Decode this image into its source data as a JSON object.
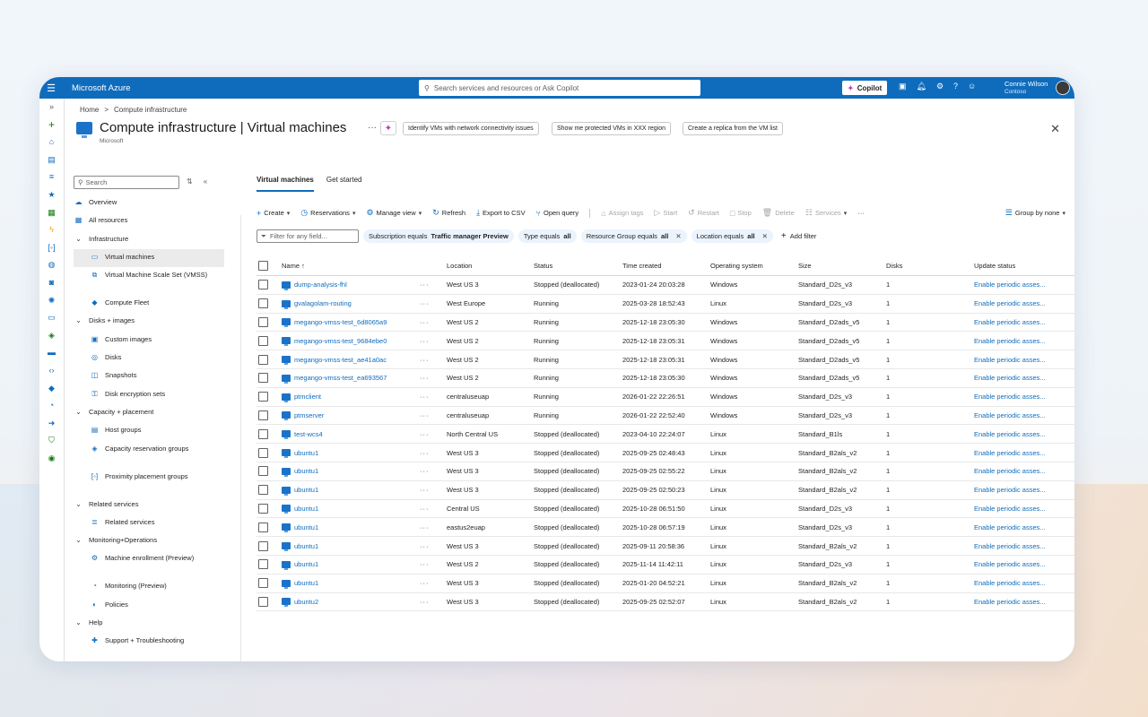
{
  "topbar": {
    "brand": "Microsoft Azure",
    "search_placeholder": "Search services and resources or Ask Copilot",
    "copilot_label": "Copilot",
    "user_name": "Connie Wilson",
    "user_org": "Contoso"
  },
  "breadcrumb": [
    "Home",
    "Compute infrastructure"
  ],
  "page": {
    "title": "Compute infrastructure | Virtual machines",
    "subtitle": "Microsoft",
    "suggestions": [
      "Identify VMs with network connectivity issues",
      "Show me protected VMs in XXX region",
      "Create a replica from the VM list"
    ]
  },
  "leftnav": {
    "search_placeholder": "Search",
    "items": [
      {
        "label": "Overview",
        "level": 0,
        "icon": "cloud-icon"
      },
      {
        "label": "All resources",
        "level": 0,
        "icon": "grid-icon"
      },
      {
        "label": "Infrastructure",
        "level": 0,
        "section": true
      },
      {
        "label": "Virtual machines",
        "level": 1,
        "icon": "vm-icon",
        "active": true
      },
      {
        "label": "Virtual Machine Scale Set (VMSS)",
        "level": 1,
        "icon": "vmss-icon",
        "tall": true
      },
      {
        "label": "Compute Fleet",
        "level": 1,
        "icon": "fleet-icon"
      },
      {
        "label": "Disks + images",
        "level": 0,
        "section": true
      },
      {
        "label": "Custom images",
        "level": 1,
        "icon": "image-icon"
      },
      {
        "label": "Disks",
        "level": 1,
        "icon": "disk-icon"
      },
      {
        "label": "Snapshots",
        "level": 1,
        "icon": "snapshot-icon"
      },
      {
        "label": "Disk encryption sets",
        "level": 1,
        "icon": "key-icon"
      },
      {
        "label": "Capacity + placement",
        "level": 0,
        "section": true
      },
      {
        "label": "Host groups",
        "level": 1,
        "icon": "host-icon"
      },
      {
        "label": "Capacity reservation groups",
        "level": 1,
        "icon": "cube-icon",
        "tall": true
      },
      {
        "label": "Proximity placement groups",
        "level": 1,
        "icon": "bracket-icon",
        "tall": true
      },
      {
        "label": "Related services",
        "level": 0,
        "section": true
      },
      {
        "label": "Related services",
        "level": 1,
        "icon": "list-icon"
      },
      {
        "label": "Monitoring+Operations",
        "level": 0,
        "section": true
      },
      {
        "label": "Machine enrollment (Preview)",
        "level": 1,
        "icon": "gear-icon",
        "tall": true
      },
      {
        "label": "Monitoring (Preview)",
        "level": 1,
        "icon": "monitor-icon"
      },
      {
        "label": "Policies",
        "level": 1,
        "icon": "policy-icon"
      },
      {
        "label": "Help",
        "level": 0,
        "section": true
      },
      {
        "label": "Support + Troubleshooting",
        "level": 1,
        "icon": "support-icon"
      }
    ]
  },
  "tabs": [
    "Virtual machines",
    "Get started"
  ],
  "toolbar": {
    "create": "Create",
    "reservations": "Reservations",
    "manage_view": "Manage view",
    "refresh": "Refresh",
    "export_csv": "Export to CSV",
    "open_query": "Open query",
    "assign_tags": "Assign tags",
    "start": "Start",
    "restart": "Restart",
    "stop": "Stop",
    "delete": "Delete",
    "services": "Services",
    "group_by": "Group by none"
  },
  "filters": {
    "placeholder": "Filter for any field...",
    "pills": [
      {
        "key": "Subscription equals ",
        "value": "Traffic manager Preview",
        "removable": false
      },
      {
        "key": "Type equals ",
        "value": "all",
        "removable": false
      },
      {
        "key": "Resource Group equals ",
        "value": "all",
        "removable": true
      },
      {
        "key": "Location equals ",
        "value": "all",
        "removable": true
      }
    ],
    "add_filter": "Add filter"
  },
  "table": {
    "columns": [
      "Name ↑",
      "Location",
      "Status",
      "Time created",
      "Operating system",
      "Size",
      "Disks",
      "Update status"
    ],
    "rows": [
      [
        "dump-analysis-fhl",
        "West US 3",
        "Stopped (deallocated)",
        "2023-01-24 20:03:28",
        "Windows",
        "Standard_D2s_v3",
        "1",
        "Enable periodic asses..."
      ],
      [
        "gvalagolam-routing",
        "West Europe",
        "Running",
        "2025-03-28 18:52:43",
        "Linux",
        "Standard_D2s_v3",
        "1",
        "Enable periodic asses..."
      ],
      [
        "megango-vmss-test_6d8065a9",
        "West US 2",
        "Running",
        "2025-12-18 23:05:30",
        "Windows",
        "Standard_D2ads_v5",
        "1",
        "Enable periodic asses..."
      ],
      [
        "megango-vmss-test_9684ebe0",
        "West US 2",
        "Running",
        "2025-12-18 23:05:31",
        "Windows",
        "Standard_D2ads_v5",
        "1",
        "Enable periodic asses..."
      ],
      [
        "megango-vmss-test_ae41a0ac",
        "West US 2",
        "Running",
        "2025-12-18 23:05:31",
        "Windows",
        "Standard_D2ads_v5",
        "1",
        "Enable periodic asses..."
      ],
      [
        "megango-vmss-test_ea693567",
        "West US 2",
        "Running",
        "2025-12-18 23:05:30",
        "Windows",
        "Standard_D2ads_v5",
        "1",
        "Enable periodic asses..."
      ],
      [
        "ptmclient",
        "centraluseuap",
        "Running",
        "2026-01-22 22:26:51",
        "Windows",
        "Standard_D2s_v3",
        "1",
        "Enable periodic asses..."
      ],
      [
        "ptmserver",
        "centraluseuap",
        "Running",
        "2026-01-22 22:52:40",
        "Windows",
        "Standard_D2s_v3",
        "1",
        "Enable periodic asses..."
      ],
      [
        "test-wcs4",
        "North Central US",
        "Stopped (deallocated)",
        "2023-04-10 22:24:07",
        "Linux",
        "Standard_B1ls",
        "1",
        "Enable periodic asses..."
      ],
      [
        "ubuntu1",
        "West US 3",
        "Stopped (deallocated)",
        "2025-09-25 02:48:43",
        "Linux",
        "Standard_B2als_v2",
        "1",
        "Enable periodic asses..."
      ],
      [
        "ubuntu1",
        "West US 3",
        "Stopped (deallocated)",
        "2025-09-25 02:55:22",
        "Linux",
        "Standard_B2als_v2",
        "1",
        "Enable periodic asses..."
      ],
      [
        "ubuntu1",
        "West US 3",
        "Stopped (deallocated)",
        "2025-09-25 02:50:23",
        "Linux",
        "Standard_B2als_v2",
        "1",
        "Enable periodic asses..."
      ],
      [
        "ubuntu1",
        "Central US",
        "Stopped (deallocated)",
        "2025-10-28 06:51:50",
        "Linux",
        "Standard_D2s_v3",
        "1",
        "Enable periodic asses..."
      ],
      [
        "ubuntu1",
        "eastus2euap",
        "Stopped (deallocated)",
        "2025-10-28 06:57:19",
        "Linux",
        "Standard_D2s_v3",
        "1",
        "Enable periodic asses..."
      ],
      [
        "ubuntu1",
        "West US 3",
        "Stopped (deallocated)",
        "2025-09-11 20:58:36",
        "Linux",
        "Standard_B2als_v2",
        "1",
        "Enable periodic asses..."
      ],
      [
        "ubuntu1",
        "West US 2",
        "Stopped (deallocated)",
        "2025-11-14 11:42:11",
        "Linux",
        "Standard_D2s_v3",
        "1",
        "Enable periodic asses..."
      ],
      [
        "ubuntu1",
        "West US 3",
        "Stopped (deallocated)",
        "2025-01-20 04:52:21",
        "Linux",
        "Standard_B2als_v2",
        "1",
        "Enable periodic asses..."
      ],
      [
        "ubuntu2",
        "West US 3",
        "Stopped (deallocated)",
        "2025-09-25 02:52:07",
        "Linux",
        "Standard_B2als_v2",
        "1",
        "Enable periodic asses..."
      ]
    ]
  },
  "colors": {
    "brand_blue": "#0f6cbd",
    "link": "#0f6cbd",
    "pill_bg": "#ebf3fc"
  }
}
